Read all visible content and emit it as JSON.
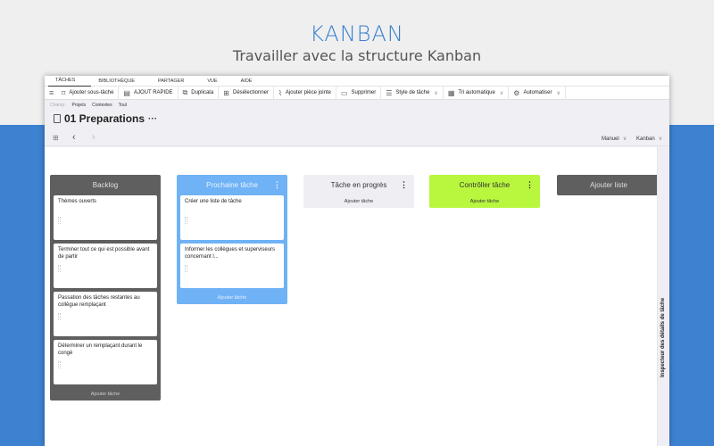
{
  "hero": {
    "title": "KANBAN",
    "subtitle": "Travailler avec la structure Kanban"
  },
  "menu_tabs": [
    {
      "label": "TÂCHES",
      "active": true
    },
    {
      "label": "BIBLIOTHÈQUE",
      "active": false
    },
    {
      "label": "PARTAGER",
      "active": false
    },
    {
      "label": "VUE",
      "active": false
    },
    {
      "label": "AIDE",
      "active": false
    }
  ],
  "toolbar": {
    "menu_icon": "hamburger-icon",
    "items": [
      {
        "label": "Ajouter sous-tâche",
        "icon": "add-subtask-icon"
      },
      {
        "label": "AJOUT RAPIDE",
        "icon": "quick-add-icon"
      },
      {
        "label": "Duplicata",
        "icon": "duplicate-icon"
      },
      {
        "label": "Désélectionner",
        "icon": "deselect-icon"
      },
      {
        "label": "Ajouter pièce jointe",
        "icon": "paperclip-icon"
      },
      {
        "label": "Supprimer",
        "icon": "delete-icon"
      },
      {
        "label": "Style de tâche",
        "icon": "style-icon",
        "dropdown": true
      },
      {
        "label": "Tri automatique",
        "icon": "sort-icon",
        "dropdown": true
      },
      {
        "label": "Automatiser",
        "icon": "gears-icon",
        "dropdown": true
      }
    ]
  },
  "scope": {
    "label": "Champ:",
    "options": [
      "Projets",
      "Contextes",
      "Tout"
    ]
  },
  "page": {
    "title": "01 Preparations",
    "more": "···"
  },
  "nav": {
    "sort_select": "Manuel",
    "view_select": "Kanban"
  },
  "columns": [
    {
      "title": "Backlog",
      "has_menu": false,
      "cards": [
        "Thèmes ouverts",
        "Terminer tout ce qui est possible avant de partir",
        "Passation des tâches restantes au collègue remplaçant",
        "Déterminer un remplaçant durant le congé"
      ],
      "add_label": "Ajouter tâche"
    },
    {
      "title": "Prochaine tâche",
      "has_menu": true,
      "cards": [
        "Créer une liste de tâche",
        "Informer les collègues et superviseurs concernant l..."
      ],
      "add_label": "Ajouter tâche"
    },
    {
      "title": "Tâche en progrès",
      "has_menu": true,
      "cards": [],
      "add_label": "Ajouter tâche"
    },
    {
      "title": "Contrôller tâche",
      "has_menu": true,
      "cards": [],
      "add_label": "Ajouter tâche"
    }
  ],
  "add_list_label": "Ajouter liste",
  "inspector_label": "Inspecteur des détails de tâche",
  "colors": {
    "backlog": "#5f5f5f",
    "next": "#6fb2f6",
    "progress": "#efeef3",
    "control": "#b8f73e",
    "brand_blue": "#3d82d0"
  }
}
